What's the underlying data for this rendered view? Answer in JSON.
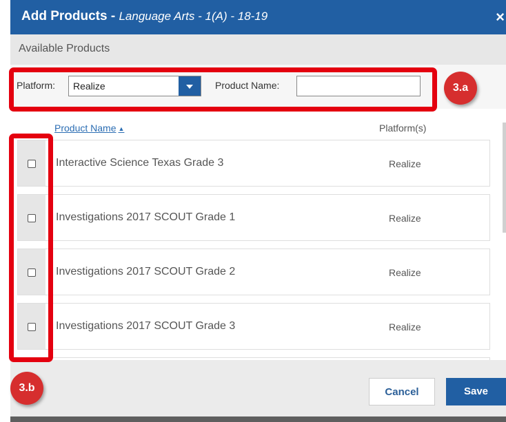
{
  "dialog": {
    "title": "Add Products - ",
    "subtitle": "Language Arts - 1(A) - 18-19",
    "close_glyph": "×",
    "section_label": "Available Products"
  },
  "filter": {
    "platform_label": "Platform:",
    "platform_value": "Realize",
    "product_name_label": "Product Name:",
    "product_name_value": ""
  },
  "table": {
    "columns": [
      "Product Name",
      "Platform(s)"
    ],
    "sort_indicator": "▲",
    "rows": [
      {
        "name": "Interactive Science Texas Grade 3",
        "platform": "Realize",
        "checked": false
      },
      {
        "name": "Investigations 2017 SCOUT Grade 1",
        "platform": "Realize",
        "checked": false
      },
      {
        "name": "Investigations 2017 SCOUT Grade 2",
        "platform": "Realize",
        "checked": false
      },
      {
        "name": "Investigations 2017 SCOUT Grade 3",
        "platform": "Realize",
        "checked": false
      }
    ]
  },
  "footer": {
    "cancel_label": "Cancel",
    "save_label": "Save"
  },
  "annotations": {
    "badge_a": "3.a",
    "badge_b": "3.b",
    "color": "#e4000f"
  },
  "colors": {
    "primary": "#215fa3",
    "badge": "#d62e2e"
  }
}
